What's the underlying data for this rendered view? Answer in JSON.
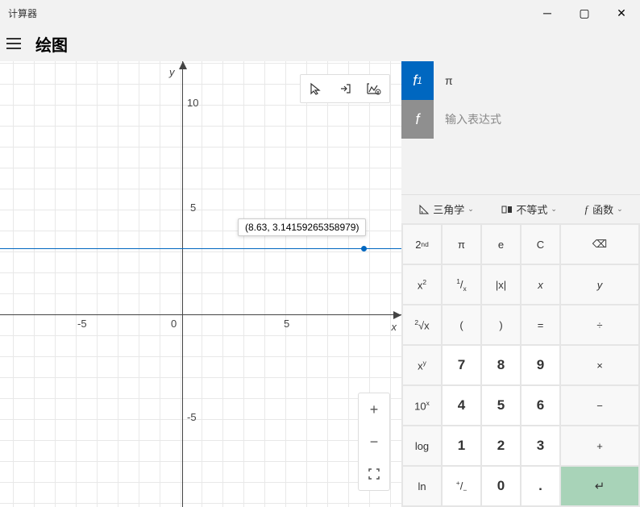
{
  "window": {
    "title": "计算器",
    "page_title": "绘图"
  },
  "graph": {
    "x_label": "x",
    "y_label": "y",
    "origin_label": "0",
    "x_ticks": [
      {
        "v": "-5",
        "px": 96
      },
      {
        "v": "5",
        "px": 346
      }
    ],
    "y_ticks": [
      {
        "v": "10",
        "px": 48
      },
      {
        "v": "5",
        "px": 178
      },
      {
        "v": "-5",
        "px": 438
      }
    ],
    "tooltip": "(8.63, 3.14159265358979)"
  },
  "chart_data": {
    "type": "line",
    "expression": "π",
    "series": [
      {
        "name": "f₁",
        "y_const": 3.14159265358979
      }
    ],
    "cursor_point": {
      "x": 8.63,
      "y": 3.14159265358979
    },
    "xlim": [
      -9,
      10.5
    ],
    "ylim": [
      -9,
      11
    ],
    "xlabel": "x",
    "ylabel": "y",
    "grid": true
  },
  "expressions": {
    "f1_label": "f",
    "f1_sub": "1",
    "f1_value": "π",
    "add_label": "f",
    "add_placeholder": "输入表达式"
  },
  "categories": {
    "trig": "三角学",
    "ineq": "不等式",
    "func": "函数"
  },
  "keys": {
    "r0": [
      "2ⁿᵈ",
      "π",
      "e",
      "C",
      "⌫"
    ],
    "r1": [
      "x²",
      "¹/ₓ",
      "|x|",
      "x",
      "y"
    ],
    "r2": [
      "²√x",
      "(",
      ")",
      "=",
      "÷"
    ],
    "r3": [
      "xʸ",
      "7",
      "8",
      "9",
      "×"
    ],
    "r4": [
      "10ˣ",
      "4",
      "5",
      "6",
      "−"
    ],
    "r5": [
      "log",
      "1",
      "2",
      "3",
      "+"
    ],
    "r6": [
      "ln",
      "⁺/₋",
      "0",
      ".",
      "↵"
    ]
  }
}
